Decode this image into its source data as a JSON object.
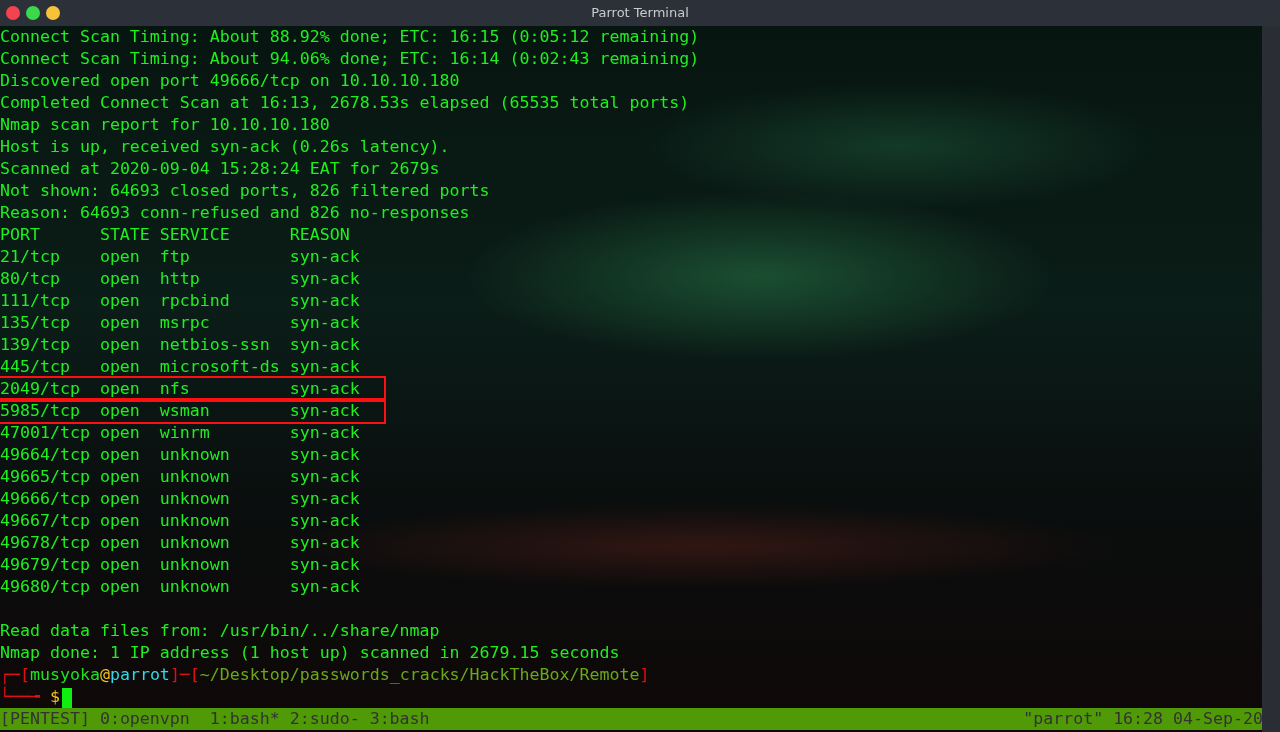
{
  "window": {
    "title": "Parrot Terminal"
  },
  "output_lines": [
    "Connect Scan Timing: About 88.92% done; ETC: 16:15 (0:05:12 remaining)",
    "Connect Scan Timing: About 94.06% done; ETC: 16:14 (0:02:43 remaining)",
    "Discovered open port 49666/tcp on 10.10.10.180",
    "Completed Connect Scan at 16:13, 2678.53s elapsed (65535 total ports)",
    "Nmap scan report for 10.10.10.180",
    "Host is up, received syn-ack (0.26s latency).",
    "Scanned at 2020-09-04 15:28:24 EAT for 2679s",
    "Not shown: 64693 closed ports, 826 filtered ports",
    "Reason: 64693 conn-refused and 826 no-responses"
  ],
  "port_table": {
    "columns": [
      "PORT",
      "STATE",
      "SERVICE",
      "REASON"
    ],
    "rows": [
      {
        "port": "21/tcp",
        "state": "open",
        "service": "ftp",
        "reason": "syn-ack",
        "highlighted": false
      },
      {
        "port": "80/tcp",
        "state": "open",
        "service": "http",
        "reason": "syn-ack",
        "highlighted": false
      },
      {
        "port": "111/tcp",
        "state": "open",
        "service": "rpcbind",
        "reason": "syn-ack",
        "highlighted": false
      },
      {
        "port": "135/tcp",
        "state": "open",
        "service": "msrpc",
        "reason": "syn-ack",
        "highlighted": false
      },
      {
        "port": "139/tcp",
        "state": "open",
        "service": "netbios-ssn",
        "reason": "syn-ack",
        "highlighted": false
      },
      {
        "port": "445/tcp",
        "state": "open",
        "service": "microsoft-ds",
        "reason": "syn-ack",
        "highlighted": false
      },
      {
        "port": "2049/tcp",
        "state": "open",
        "service": "nfs",
        "reason": "syn-ack",
        "highlighted": true
      },
      {
        "port": "5985/tcp",
        "state": "open",
        "service": "wsman",
        "reason": "syn-ack",
        "highlighted": true
      },
      {
        "port": "47001/tcp",
        "state": "open",
        "service": "winrm",
        "reason": "syn-ack",
        "highlighted": false
      },
      {
        "port": "49664/tcp",
        "state": "open",
        "service": "unknown",
        "reason": "syn-ack",
        "highlighted": false
      },
      {
        "port": "49665/tcp",
        "state": "open",
        "service": "unknown",
        "reason": "syn-ack",
        "highlighted": false
      },
      {
        "port": "49666/tcp",
        "state": "open",
        "service": "unknown",
        "reason": "syn-ack",
        "highlighted": false
      },
      {
        "port": "49667/tcp",
        "state": "open",
        "service": "unknown",
        "reason": "syn-ack",
        "highlighted": false
      },
      {
        "port": "49678/tcp",
        "state": "open",
        "service": "unknown",
        "reason": "syn-ack",
        "highlighted": false
      },
      {
        "port": "49679/tcp",
        "state": "open",
        "service": "unknown",
        "reason": "syn-ack",
        "highlighted": false
      },
      {
        "port": "49680/tcp",
        "state": "open",
        "service": "unknown",
        "reason": "syn-ack",
        "highlighted": false
      }
    ]
  },
  "footer_lines": [
    "Read data files from: /usr/bin/../share/nmap",
    "Nmap done: 1 IP address (1 host up) scanned in 2679.15 seconds"
  ],
  "prompt": {
    "segments": [
      {
        "kind": "frame",
        "text": "┌─["
      },
      {
        "kind": "user",
        "text": "musyoka"
      },
      {
        "kind": "at",
        "text": "@"
      },
      {
        "kind": "host",
        "text": "parrot"
      },
      {
        "kind": "frame",
        "text": "]─["
      },
      {
        "kind": "path",
        "text": "~/Desktop/passwords_cracks/HackTheBox/Remote"
      },
      {
        "kind": "frame",
        "text": "]"
      }
    ],
    "corner": "└──╼",
    "symbol": "$"
  },
  "status_bar": {
    "left": "[PENTEST] 0:openvpn  1:bash* 2:sudo- 3:bash",
    "right": "\"parrot\" 16:28 04-Sep-20"
  }
}
